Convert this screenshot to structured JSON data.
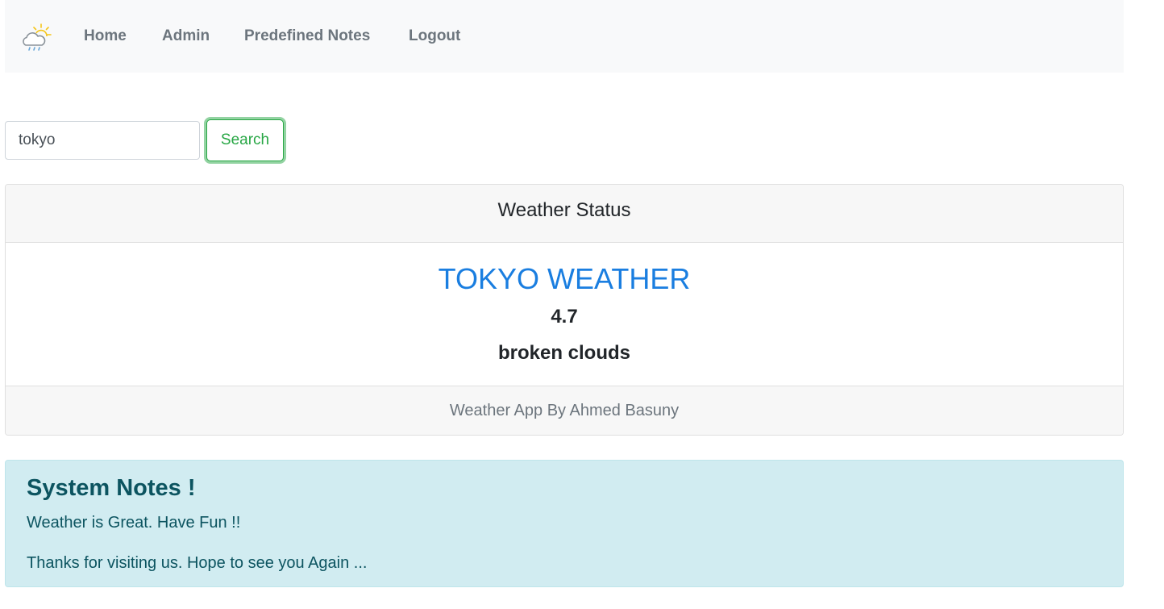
{
  "nav": {
    "brand_icon": "weather-cloud-sun-icon",
    "items": [
      {
        "label": "Home"
      },
      {
        "label": "Admin"
      },
      {
        "label": "Predefined Notes"
      },
      {
        "label": "Logout"
      }
    ]
  },
  "search": {
    "value": "tokyo",
    "button_label": "Search"
  },
  "weather_card": {
    "header": "Weather Status",
    "city_title": "TOKYO WEATHER",
    "temperature": "4.7",
    "description": "broken clouds",
    "footer": "Weather App By Ahmed Basuny"
  },
  "notes": {
    "heading": "System Notes !",
    "lines": [
      "Weather is Great. Have Fun !!",
      "Thanks for visiting us. Hope to see you Again ..."
    ]
  },
  "colors": {
    "navbar_bg": "#f8f9fa",
    "accent_blue": "#1a7ee0",
    "success_green": "#28a745",
    "info_bg": "#d1ecf1",
    "info_text": "#0c5460"
  }
}
